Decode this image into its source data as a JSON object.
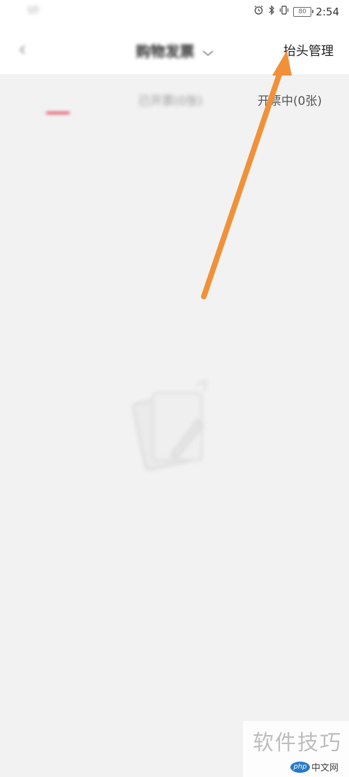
{
  "status_bar": {
    "left_text": "Ul",
    "time": "2:54",
    "battery": "80",
    "icons": [
      "alarm-icon",
      "bluetooth-icon",
      "vibrate-icon",
      "battery-icon"
    ]
  },
  "nav": {
    "back_icon": "back-arrow-icon",
    "title": "购物发票",
    "title_chevron": "chevron-down-icon",
    "right_link": "抬头管理"
  },
  "tabs": [
    {
      "label": "",
      "active": true
    },
    {
      "label": "已开票(0张)",
      "active": false
    },
    {
      "label": "开票中(0张)",
      "active": false
    }
  ],
  "empty_state": {
    "icon": "empty-invoice-icon",
    "text": ""
  },
  "annotation": {
    "type": "arrow",
    "color": "#f0913a"
  },
  "watermark": {
    "main": "软件技巧",
    "logo": "php",
    "sub": "中文网"
  },
  "colors": {
    "accent": "#e0304a",
    "background": "#f2f2f2",
    "annotation": "#f0913a"
  }
}
